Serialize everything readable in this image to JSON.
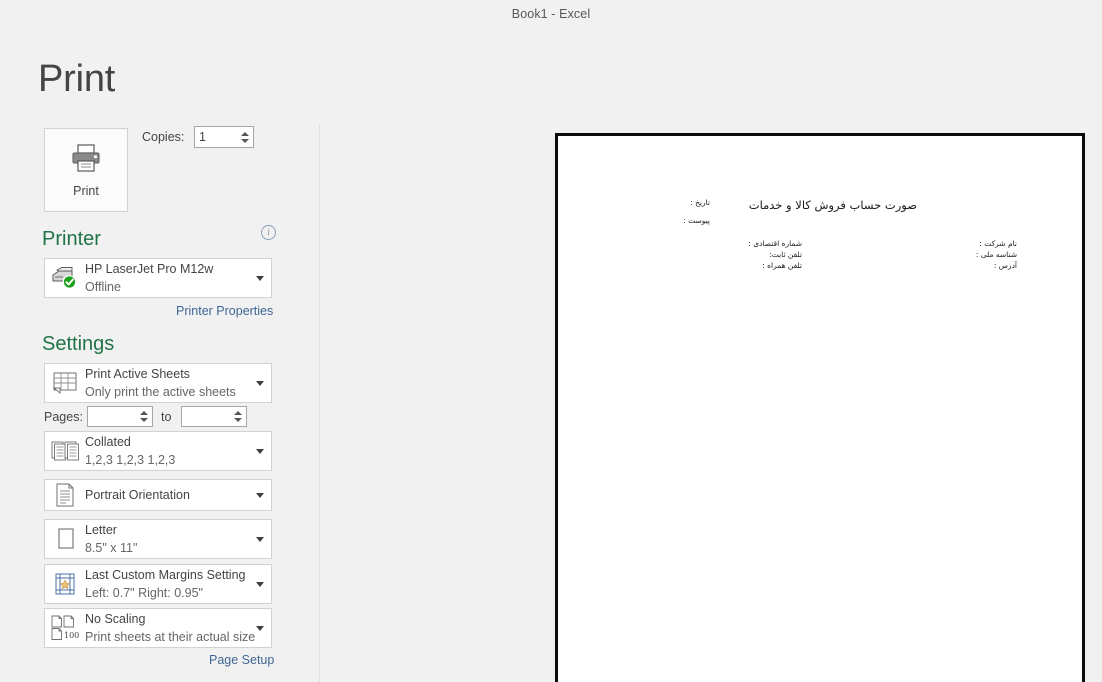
{
  "window": {
    "title": "Book1 - Excel"
  },
  "backstage": {
    "heading": "Print"
  },
  "print": {
    "button_label": "Print",
    "icon": "printer-icon",
    "copies_label": "Copies:",
    "copies_value": "1"
  },
  "printer": {
    "section_heading": "Printer",
    "info_icon": "info-icon",
    "info_glyph": "i",
    "name": "HP LaserJet Pro M12w",
    "status": "Offline",
    "icon": "printer-status-icon",
    "properties_link": "Printer Properties"
  },
  "settings": {
    "section_heading": "Settings",
    "items": [
      {
        "id": "print-what",
        "icon": "worksheet-icon",
        "title": "Print Active Sheets",
        "subtitle": "Only print the active sheets"
      },
      {
        "id": "collation",
        "icon": "collate-icon",
        "title": "Collated",
        "subtitle": "1,2,3   1,2,3   1,2,3"
      },
      {
        "id": "orientation",
        "icon": "portrait-page-icon",
        "title": "Portrait Orientation",
        "subtitle": ""
      },
      {
        "id": "paper-size",
        "icon": "paper-size-icon",
        "title": "Letter",
        "subtitle": "8.5\" x 11\""
      },
      {
        "id": "margins",
        "icon": "margins-icon",
        "title": "Last Custom Margins Setting",
        "subtitle": "Left:  0.7\"    Right:  0.95\""
      },
      {
        "id": "scaling",
        "icon": "scaling-icon",
        "title": "No Scaling",
        "subtitle": "Print sheets at their actual size",
        "badge": "100"
      }
    ],
    "pages_label": "Pages:",
    "pages_from_value": "",
    "pages_to_label": "to",
    "pages_to_value": "",
    "page_setup_link": "Page Setup"
  },
  "preview": {
    "document": {
      "title": "صورت حساب فروش کالا و خدمات",
      "date_label": "تاریخ :",
      "attachment_label": "پیوست :",
      "right_column": [
        "نام شرکت :",
        "شناسه ملی :",
        "آدرس :"
      ],
      "left_column": [
        "شماره اقتصادی :",
        "تلفن ثابت:",
        "تلفن همراه :"
      ]
    }
  },
  "colors": {
    "accent_green": "#217346",
    "link_blue": "#3f6694",
    "background": "#f1f1f1",
    "text": "#444444",
    "status_ok": "#1aa01a"
  }
}
